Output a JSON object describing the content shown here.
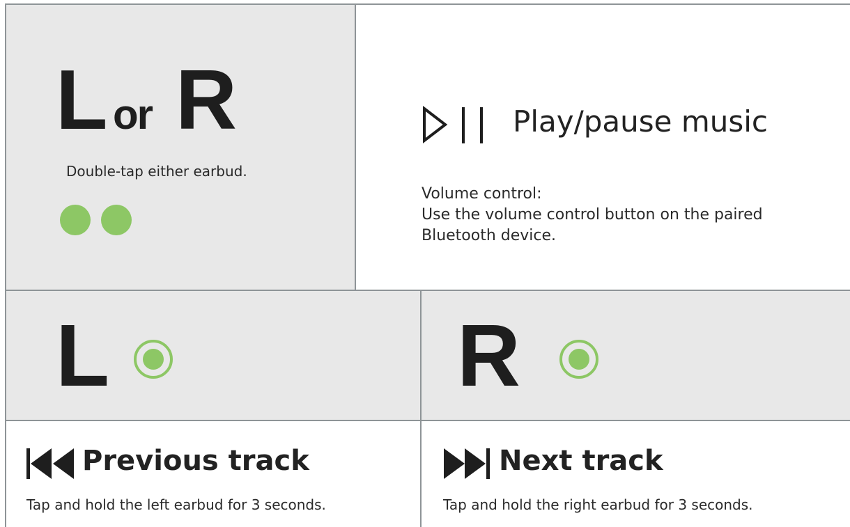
{
  "top_left": {
    "letter_left": "L",
    "or": "or",
    "letter_right": "R",
    "caption": "Double-tap either earbud."
  },
  "top_right": {
    "title": "Play/pause music",
    "volume_lines": [
      "Volume control:",
      "Use the volume control button on the paired",
      "Bluetooth device."
    ]
  },
  "left_panel": {
    "letter": "L",
    "title": "Previous track",
    "caption": "Tap and hold the left earbud for 3 seconds."
  },
  "right_panel": {
    "letter": "R",
    "title": "Next track",
    "caption": "Tap and hold the right earbud for 3 seconds."
  },
  "colors": {
    "accent_green": "#8dc765",
    "panel_grey": "#e8e8e8",
    "divider": "#8e9497"
  },
  "icons": {
    "play_pause": "play-pause-icon",
    "previous": "previous-track-icon",
    "next": "next-track-icon",
    "tap": "tap-dot-icon",
    "hold": "hold-ring-icon"
  }
}
